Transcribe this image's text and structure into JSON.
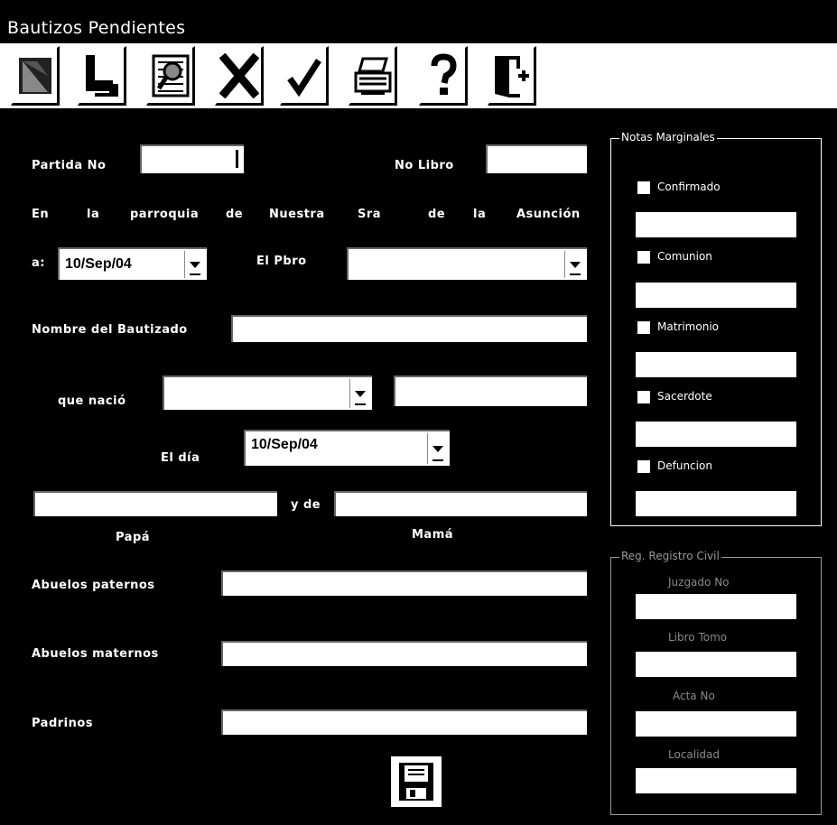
{
  "window": {
    "title": "Bautizos Pendientes"
  },
  "toolbar": {
    "buttons": [
      {
        "icon": "new-record-icon"
      },
      {
        "icon": "open-file-icon"
      },
      {
        "icon": "search-icon"
      },
      {
        "icon": "delete-x-icon"
      },
      {
        "icon": "confirm-check-icon"
      },
      {
        "icon": "printer-icon"
      },
      {
        "icon": "help-question-icon"
      },
      {
        "icon": "exit-door-icon"
      }
    ]
  },
  "form": {
    "partida_label": "Partida No",
    "libro_label": "No Libro",
    "parroquia_line": [
      "En",
      "la",
      "parroquia",
      "de",
      "Nuestra",
      "Sra",
      "de",
      "la",
      "Asunción"
    ],
    "a_label": "a:",
    "a_date": "10/Sep/04",
    "pbro_label": "El Pbro",
    "pbro_value": "",
    "nombre_label": "Nombre del Bautizado",
    "nacio_label": "que nació",
    "dia_label": "El día",
    "dia_date": "10/Sep/04",
    "y_de_label": "y de",
    "papa_label": "Papá",
    "mama_label": "Mamá",
    "abuelos_paternos_label": "Abuelos paternos",
    "abuelos_maternos_label": "Abuelos maternos",
    "padrinos_label": "Padrinos"
  },
  "notas": {
    "title": "Notas Marginales",
    "items": [
      "Confirmado",
      "Comunion",
      "Matrimonio",
      "Sacerdote",
      "Defuncion"
    ]
  },
  "registro": {
    "title": "Reg. Registro Civil",
    "fields": [
      "Juzgado No",
      "Libro Tomo",
      "Acta No",
      "Localidad"
    ]
  },
  "colors": {
    "background": "#000000",
    "field": "#ffffff"
  }
}
